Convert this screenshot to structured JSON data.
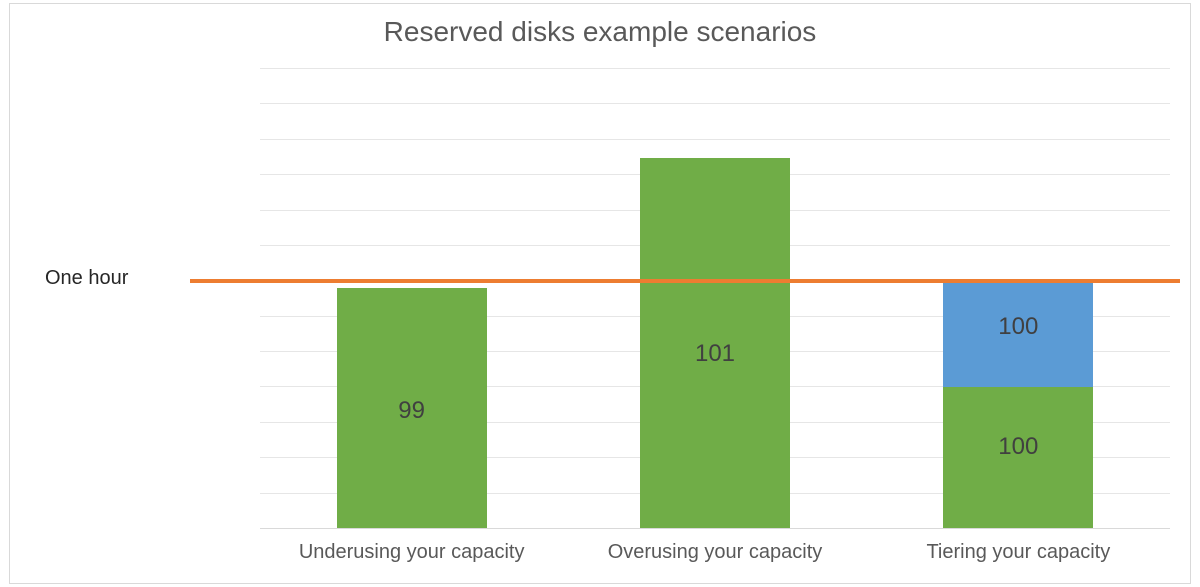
{
  "chart_data": {
    "type": "bar",
    "title": "Reserved disks example scenarios",
    "categories": [
      "Underusing your capacity",
      "Overusing your capacity",
      "Tiering your capacity"
    ],
    "series": [
      {
        "name": "green",
        "color": "#70AD47",
        "values": [
          99,
          101,
          100
        ]
      },
      {
        "name": "blue",
        "color": "#5B9BD5",
        "values": [
          null,
          null,
          100
        ]
      }
    ],
    "reference_line": {
      "label": "One hour",
      "value": 175,
      "color": "#ED7D31"
    },
    "stacked": true,
    "ymax": 325,
    "gridline_step": 25
  },
  "y_annotation": "One hour",
  "colors": {
    "green": "#70AD47",
    "blue": "#5B9BD5",
    "orange": "#ED7D31",
    "grid": "#e6e6e6",
    "text_title": "#595959",
    "text_label": "#404040"
  }
}
